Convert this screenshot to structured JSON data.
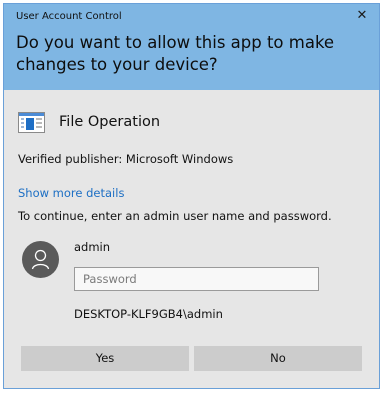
{
  "dialog": {
    "title": "User Account Control",
    "close_glyph": "✕",
    "question": "Do you want to allow this app to make changes to your device?",
    "app_name": "File Operation",
    "app_icon": "file-operation-window-icon",
    "publisher": "Verified publisher: Microsoft Windows",
    "more_details_link": "Show more details",
    "instructions": "To continue, enter an admin user name and password.",
    "avatar_icon": "user-avatar-icon",
    "username": "admin",
    "password_placeholder": "Password",
    "password_value": "",
    "domain_account": "DESKTOP-KLF9GB4\\admin",
    "yes_label": "Yes",
    "no_label": "No"
  },
  "colors": {
    "header_bg": "#7fb6e3",
    "body_bg": "#e6e6e6",
    "button_bg": "#cccccc",
    "link": "#1d6fc4",
    "border": "#6aa0d8"
  }
}
